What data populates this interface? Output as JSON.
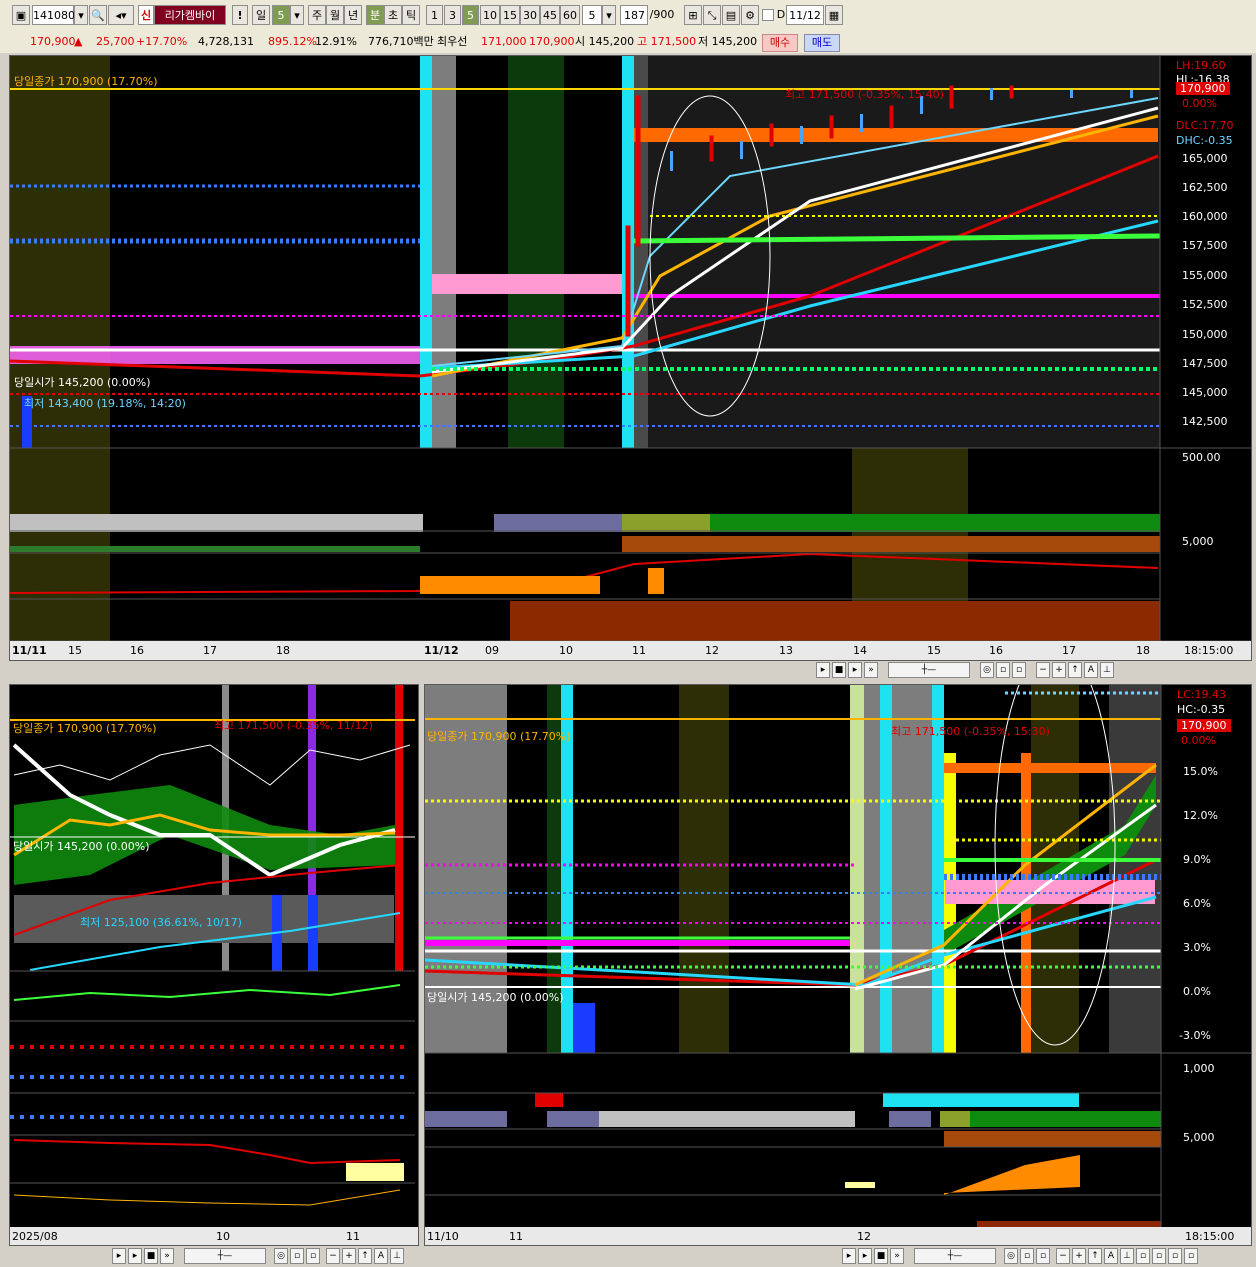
{
  "toolbar": {
    "code": "141080",
    "name": "리가켐바이",
    "market_badge": "신",
    "warn": "!",
    "period_day": "일",
    "period_n": "5",
    "period_week": "주",
    "period_month": "월",
    "period_year": "년",
    "unit_min": "분",
    "unit_sec": "초",
    "unit_tick": "틱",
    "intervals": [
      "1",
      "3",
      "5",
      "10",
      "15",
      "30",
      "45",
      "60"
    ],
    "interval_value": "5",
    "count": "187",
    "count_max": "/900",
    "date_label": "D",
    "date": "11/12"
  },
  "quote": {
    "price": "170,900",
    "arrow": "▲",
    "change": "25,700",
    "change_pct": "+17.70%",
    "volume": "4,728,131",
    "volume_ratio": "895.12%",
    "turnover": "12.91%",
    "amount": "776,710백만",
    "best_label": "최우선",
    "best_ask": "171,000",
    "best_bid": "170,900",
    "open": "시 145,200",
    "high": "고 171,500",
    "low": "저 145,200",
    "buy": "매수",
    "sell": "매도"
  },
  "top_chart": {
    "close_label": "당일종가 170,900 (17.70%)",
    "high_label": "최고 171,500 (-0.35%, 15:40)",
    "open_label": "당일시가 145,200 (0.00%)",
    "low_label": "최저 143,400 (19.18%, 14:20)",
    "lh": "LH:19.60",
    "hl": "HL:-16.38",
    "price_box": "170,900",
    "pct_box": "0.00%",
    "dlc": "DLC:17.70",
    "dhc": "DHC:-0.35",
    "y_ticks": [
      "165,000",
      "162,500",
      "160,000",
      "157,500",
      "155,000",
      "152,500",
      "150,000",
      "147,500",
      "145,000",
      "142,500"
    ],
    "ind1_tick": "500.00",
    "ind2_tick": "5,000",
    "x_labels": [
      "11/11",
      "15",
      "16",
      "17",
      "18",
      "11/12",
      "09",
      "10",
      "11",
      "12",
      "13",
      "14",
      "15",
      "16",
      "17",
      "18"
    ],
    "time": "18:15:00"
  },
  "bl_chart": {
    "close_label": "당일종가 170,900 (17.70%)",
    "high_label": "최고 171,500 (-0.35%, 11/12)",
    "open_label": "당일시가 145,200 (0.00%)",
    "low_label": "최저 125,100 (36.61%, 10/17)",
    "x_labels": [
      "2025/08",
      "10",
      "11"
    ]
  },
  "br_chart": {
    "close_label": "당일종가 170,900 (17.70%)",
    "high_label": "최고 171,500 (-0.35%, 15:30)",
    "open_label": "당일시가 145,200 (0.00%)",
    "lc": "LC:19.43",
    "hc": "HC:-0.35",
    "price_box": "170,900",
    "pct_box": "0.00%",
    "y_ticks": [
      "15.0%",
      "12.0%",
      "9.0%",
      "6.0%",
      "3.0%",
      "0.0%",
      "-3.0%"
    ],
    "ind1_tick": "1,000",
    "ind2_tick": "5,000",
    "x_labels": [
      "11/10",
      "11",
      "12"
    ],
    "time": "18:15:00"
  }
}
